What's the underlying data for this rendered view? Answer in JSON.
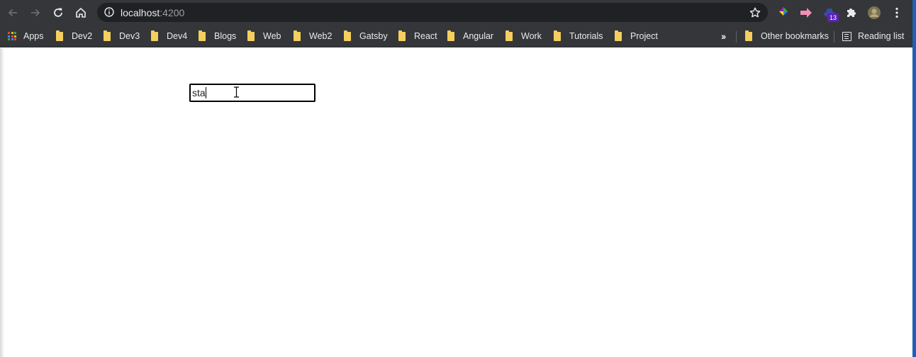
{
  "browser": {
    "url_host": "localhost",
    "url_port": ":4200",
    "extension_badge": "13"
  },
  "bookmarks": {
    "apps_label": "Apps",
    "items": [
      "Dev2",
      "Dev3",
      "Dev4",
      "Blogs",
      "Web",
      "Web2",
      "Gatsby",
      "React",
      "Angular",
      "Work",
      "Tutorials",
      "Project"
    ],
    "other_bookmarks_label": "Other bookmarks",
    "reading_list_label": "Reading list"
  },
  "page": {
    "search_value": "sta"
  }
}
